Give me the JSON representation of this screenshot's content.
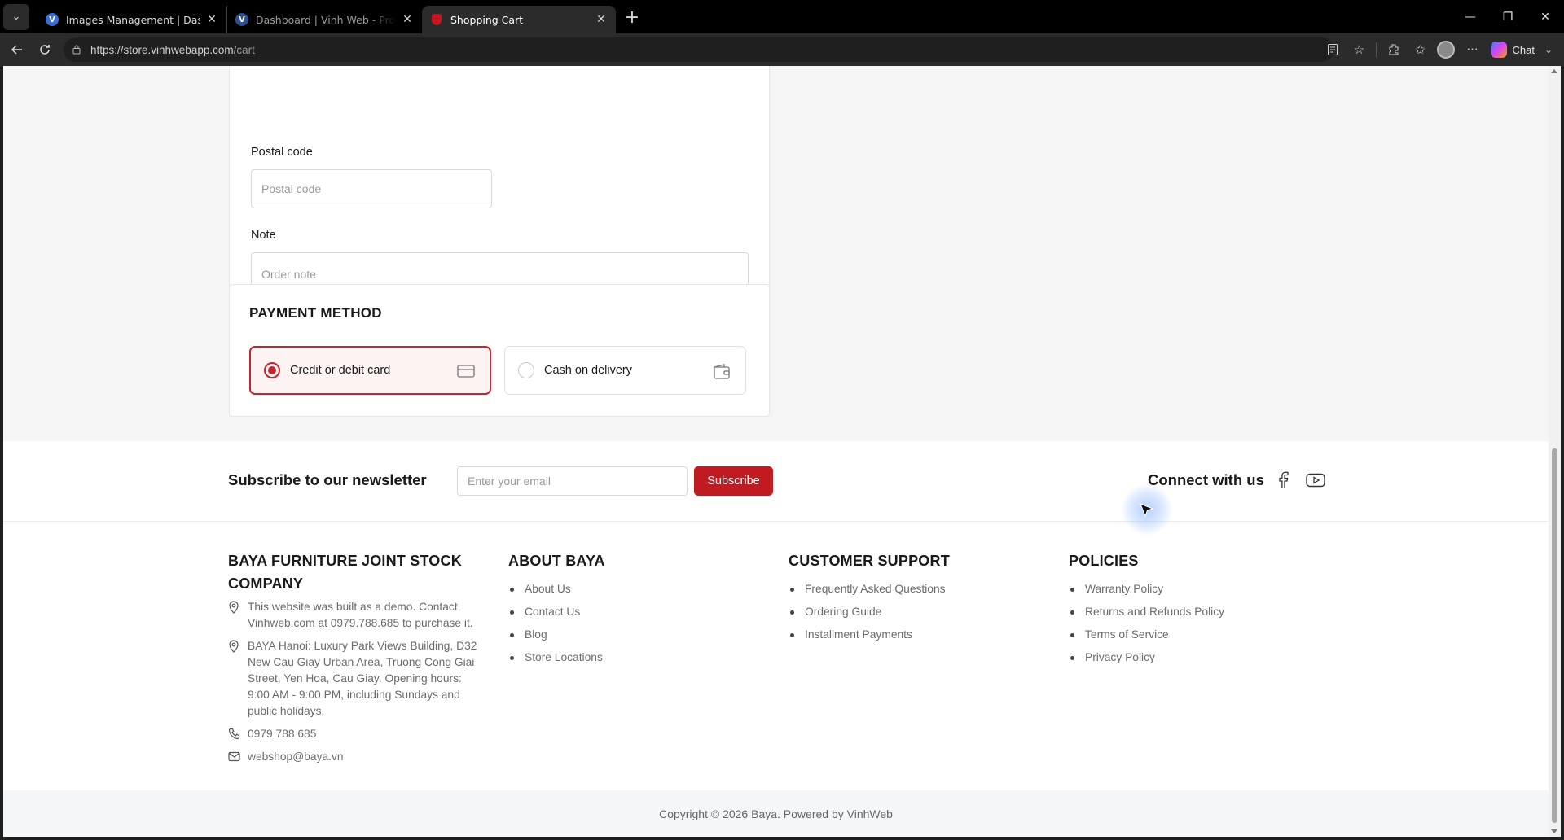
{
  "browser": {
    "tabs": [
      {
        "title": "Images Management | Dashboard",
        "favicon": "vinhweb-icon"
      },
      {
        "title": "Dashboard | Vinh Web - Professional",
        "favicon": "vinhweb-icon"
      },
      {
        "title": "Shopping Cart",
        "favicon": "cart-icon",
        "active": true
      }
    ],
    "url_host": "https://store.vinhwebapp.com",
    "url_path": "/cart",
    "chat_label": "Chat"
  },
  "form": {
    "postal_label": "Postal code",
    "postal_placeholder": "Postal code",
    "note_label": "Note",
    "note_placeholder": "Order note"
  },
  "payment": {
    "title": "PAYMENT METHOD",
    "options": [
      {
        "label": "Credit or debit card",
        "selected": true,
        "icon": "credit-card-icon"
      },
      {
        "label": "Cash on delivery",
        "selected": false,
        "icon": "wallet-icon"
      }
    ]
  },
  "newsletter": {
    "title": "Subscribe to our newsletter",
    "email_placeholder": "Enter your email",
    "button": "Subscribe",
    "connect": "Connect with us"
  },
  "footer": {
    "company": {
      "title": "BAYA FURNITURE JOINT STOCK COMPANY",
      "info": [
        {
          "icon": "location-icon",
          "text": "This website was built as a demo. Contact Vinhweb.com at 0979.788.685 to purchase it."
        },
        {
          "icon": "location-icon",
          "text": "BAYA Hanoi: Luxury Park Views Building, D32 New Cau Giay Urban Area, Truong Cong Giai Street, Yen Hoa, Cau Giay. Opening hours: 9:00 AM - 9:00 PM, including Sundays and public holidays."
        },
        {
          "icon": "phone-icon",
          "text": "0979 788 685"
        },
        {
          "icon": "mail-icon",
          "text": "webshop@baya.vn"
        }
      ]
    },
    "about": {
      "title": "ABOUT BAYA",
      "links": [
        "About Us",
        "Contact Us",
        "Blog",
        "Store Locations"
      ]
    },
    "support": {
      "title": "CUSTOMER SUPPORT",
      "links": [
        "Frequently Asked Questions",
        "Ordering Guide",
        "Installment Payments"
      ]
    },
    "policies": {
      "title": "POLICIES",
      "links": [
        "Warranty Policy",
        "Returns and Refunds Policy",
        "Terms of Service",
        "Privacy Policy"
      ]
    },
    "copyright": "Copyright © 2026 Baya. Powered by VinhWeb"
  },
  "colors": {
    "accent": "#c11b22",
    "selected_bg": "#fdf3f3"
  }
}
